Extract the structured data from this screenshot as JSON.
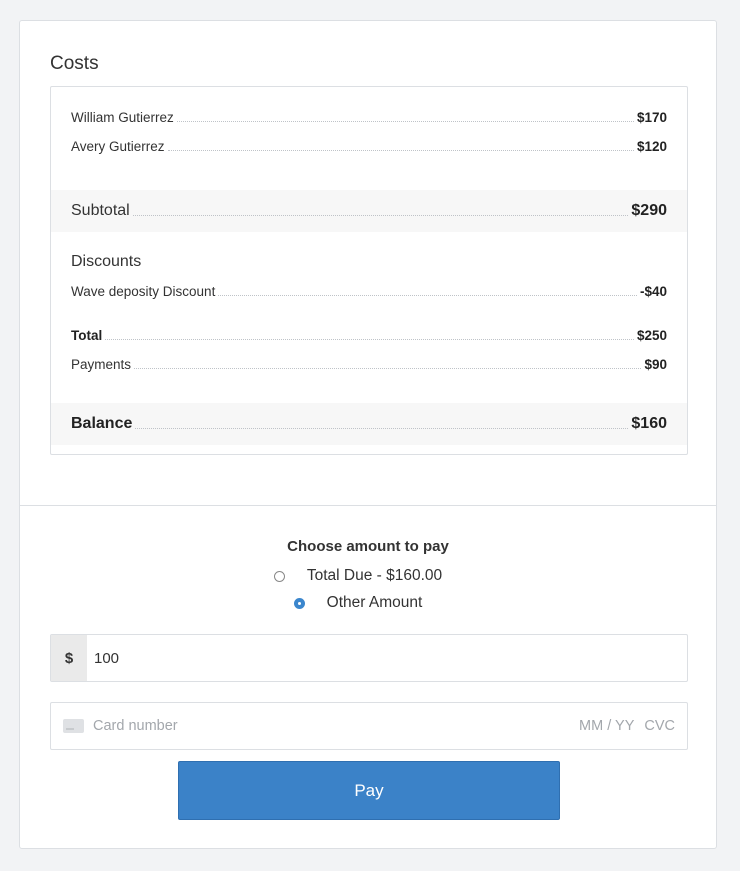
{
  "costs": {
    "title": "Costs",
    "line_items": [
      {
        "label": "William Gutierrez",
        "amount": "$170"
      },
      {
        "label": "Avery Gutierrez",
        "amount": "$120"
      }
    ],
    "subtotal": {
      "label": "Subtotal",
      "amount": "$290"
    },
    "discounts_heading": "Discounts",
    "discount": {
      "label": "Wave deposity Discount",
      "amount": "-$40"
    },
    "total": {
      "label": "Total",
      "amount": "$250"
    },
    "payments": {
      "label": "Payments",
      "amount": "$90"
    },
    "balance": {
      "label": "Balance",
      "amount": "$160"
    }
  },
  "payment": {
    "choose_title": "Choose amount to pay",
    "options": [
      {
        "label": "Total Due - $160.00",
        "selected": false
      },
      {
        "label": "Other Amount",
        "selected": true
      }
    ],
    "currency_symbol": "$",
    "amount_value": "100",
    "card_number_placeholder": "Card number",
    "expiry_placeholder": "MM / YY",
    "cvc_placeholder": "CVC",
    "pay_label": "Pay"
  },
  "colors": {
    "accent": "#3b82c8",
    "background": "#f2f3f5"
  }
}
